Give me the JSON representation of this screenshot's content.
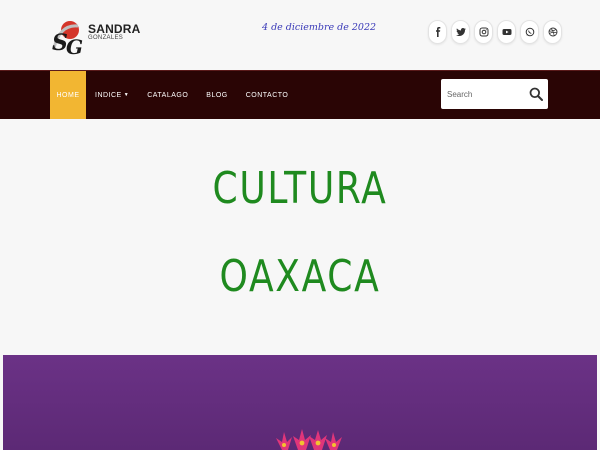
{
  "brand": {
    "name": "SANDRA",
    "subtitle": "GONZALES",
    "mark_text": "SG"
  },
  "header": {
    "date": "4 de diciembre de 2022"
  },
  "social": [
    "facebook-icon",
    "twitter-icon",
    "instagram-icon",
    "youtube-icon",
    "whatsapp-icon",
    "dribbble-icon"
  ],
  "nav": {
    "items": [
      {
        "label": "HOME",
        "active": true
      },
      {
        "label": "INDICE",
        "caret": true
      },
      {
        "label": "CATALAGO"
      },
      {
        "label": "BLOG"
      },
      {
        "label": "CONTACTO"
      }
    ]
  },
  "search": {
    "placeholder": "Search"
  },
  "hero": {
    "line1": "CULTURA",
    "line2": "OAXACA"
  },
  "colors": {
    "navbar": "#2a0505",
    "active": "#f2b632",
    "hero_text": "#1f8a1f",
    "date": "#3a3ab8",
    "purple": "#6b3286"
  }
}
